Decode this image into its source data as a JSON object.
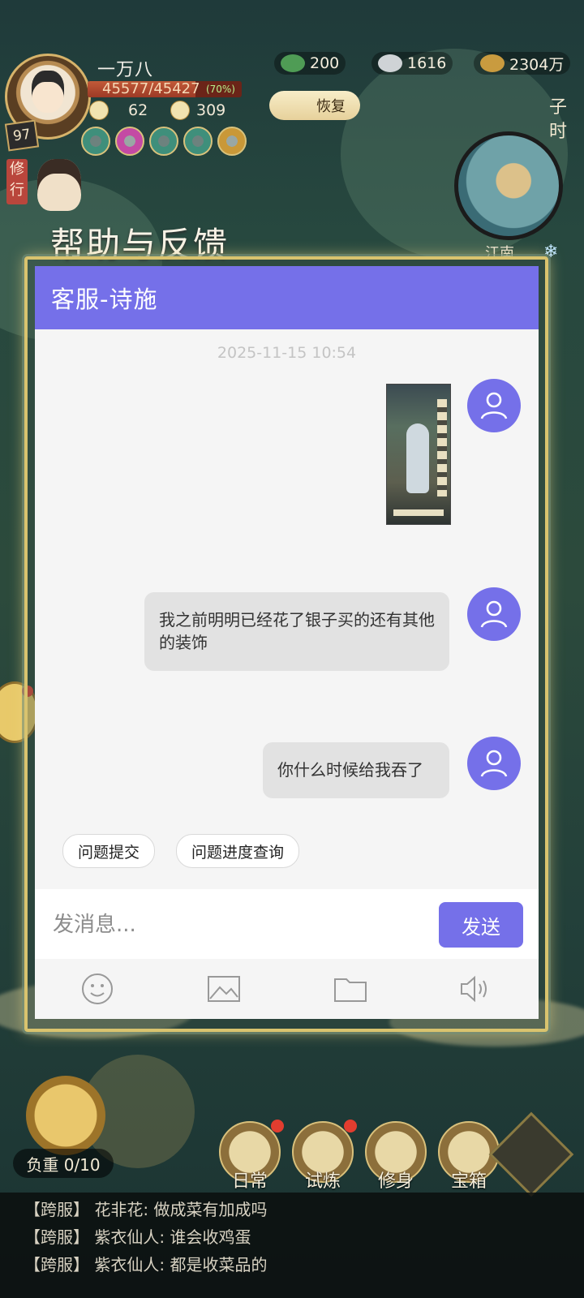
{
  "hud": {
    "player_name": "一万八",
    "level": "97",
    "hp_text": "45577/45427",
    "hp_percent_label": "(70%)",
    "hp_fraction": 0.7,
    "stat1": "62",
    "stat2": "309",
    "resources": [
      "200",
      "1616",
      "2304万"
    ],
    "restore_label": "恢复",
    "time_label": "子时",
    "location": "江南",
    "cultivate_tag": "修行"
  },
  "help": {
    "title": "帮助与反馈",
    "header": "客服-诗施",
    "timestamp": "2025-11-15 10:54",
    "messages": [
      {
        "type": "image",
        "icon": "user-avatar-icon"
      },
      {
        "type": "text",
        "text": "我之前明明已经花了银子买的还有其他的装饰"
      },
      {
        "type": "text",
        "text": "你什么时候给我吞了"
      }
    ],
    "quick_actions": [
      "问题提交",
      "问题进度查询"
    ],
    "input_placeholder": "发消息...",
    "send_label": "发送",
    "tools": [
      "emoji-icon",
      "image-icon",
      "folder-icon",
      "voice-icon"
    ],
    "accent_color": "#7570e9"
  },
  "bottom": {
    "burden": "负重 0/10",
    "nav": [
      "日常",
      "试炼",
      "修身",
      "宝箱"
    ],
    "chat_log": [
      {
        "channel": "【跨服】",
        "text": "花非花: 做成菜有加成吗"
      },
      {
        "channel": "【跨服】",
        "text": "紫衣仙人: 谁会收鸡蛋"
      },
      {
        "channel": "【跨服】",
        "text": "紫衣仙人: 都是收菜品的"
      }
    ]
  }
}
